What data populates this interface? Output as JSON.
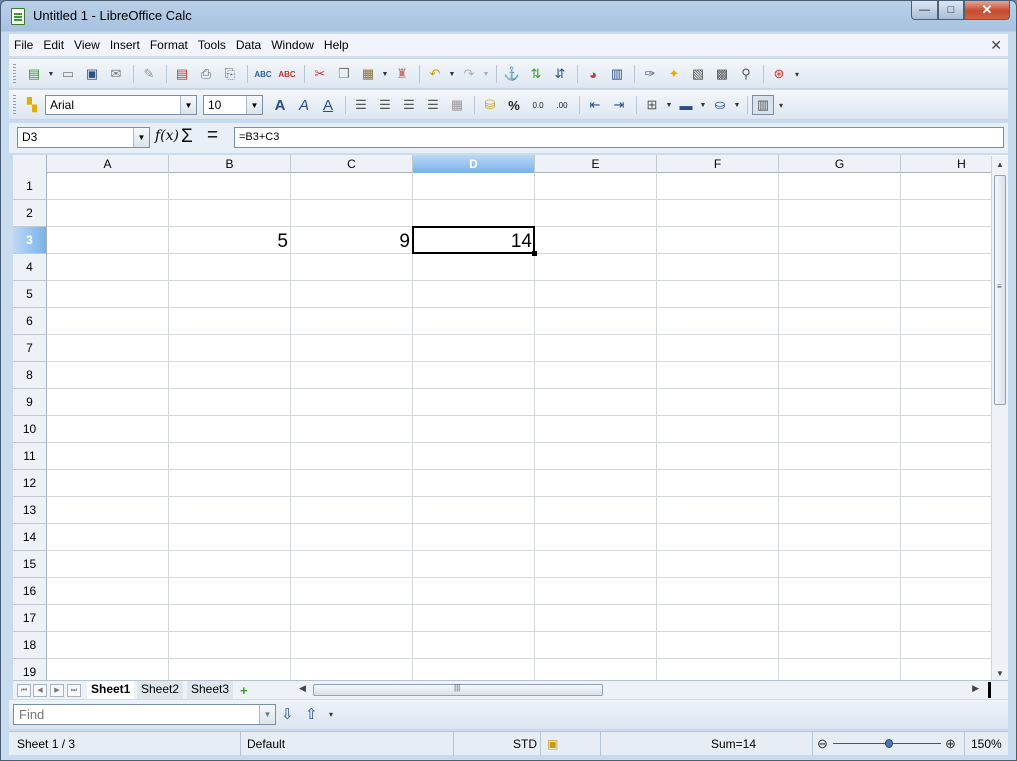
{
  "window": {
    "title": "Untitled 1 - LibreOffice Calc",
    "controls": {
      "minimize": "—",
      "maximize": "□",
      "close": "✕"
    }
  },
  "menu": {
    "items": [
      "File",
      "Edit",
      "View",
      "Insert",
      "Format",
      "Tools",
      "Data",
      "Window",
      "Help"
    ],
    "close": "✕"
  },
  "toolbar_standard": {
    "icons": [
      "new-icon",
      "open-icon",
      "save-icon",
      "email-icon",
      "edit-file-icon",
      "export-pdf-icon",
      "print-icon",
      "print-preview-icon",
      "spellcheck-icon",
      "autospellcheck-icon",
      "cut-icon",
      "copy-icon",
      "paste-icon",
      "clone-formatting-icon",
      "undo-icon",
      "redo-icon",
      "hyperlink-icon",
      "sort-ascending-icon",
      "sort-descending-icon",
      "chart-icon",
      "draw-functions-icon",
      "navigator-icon",
      "gallery-icon",
      "datasources-icon",
      "zoom-icon",
      "help-icon"
    ]
  },
  "toolbar_formatting": {
    "font_name": "Arial",
    "font_size": "10",
    "icons": [
      "bold-icon",
      "italic-icon",
      "underline-icon",
      "align-left-icon",
      "align-center-icon",
      "align-right-icon",
      "justify-icon",
      "merge-cells-icon",
      "currency-icon",
      "percent-icon",
      "standard-format-icon",
      "add-decimal-icon",
      "delete-decimal-icon",
      "decrease-indent-icon",
      "increase-indent-icon",
      "borders-icon",
      "background-color-icon",
      "font-color-icon",
      "gridlines-icon"
    ]
  },
  "formula_bar": {
    "name_box": "D3",
    "fx": "f(x)",
    "sigma": "Σ",
    "equals": "=",
    "formula": "=B3+C3"
  },
  "grid": {
    "columns": [
      "A",
      "B",
      "C",
      "D",
      "E",
      "F",
      "G",
      "H"
    ],
    "rows": [
      "1",
      "2",
      "3",
      "4",
      "5",
      "6",
      "7",
      "8",
      "9",
      "10",
      "11",
      "12",
      "13",
      "14",
      "15",
      "16",
      "17",
      "18",
      "19"
    ],
    "active_cell": "D3",
    "cells": {
      "B3": "5",
      "C3": "9",
      "D3": "14"
    }
  },
  "sheets": {
    "tabs": [
      "Sheet1",
      "Sheet2",
      "Sheet3"
    ],
    "active": "Sheet1",
    "add": "+"
  },
  "findbar": {
    "placeholder": "Find",
    "down": "⇩",
    "up": "⇧"
  },
  "status": {
    "sheet": "Sheet 1 / 3",
    "style": "Default",
    "mode": "STD",
    "sum": "Sum=14",
    "zoom": "150%"
  }
}
